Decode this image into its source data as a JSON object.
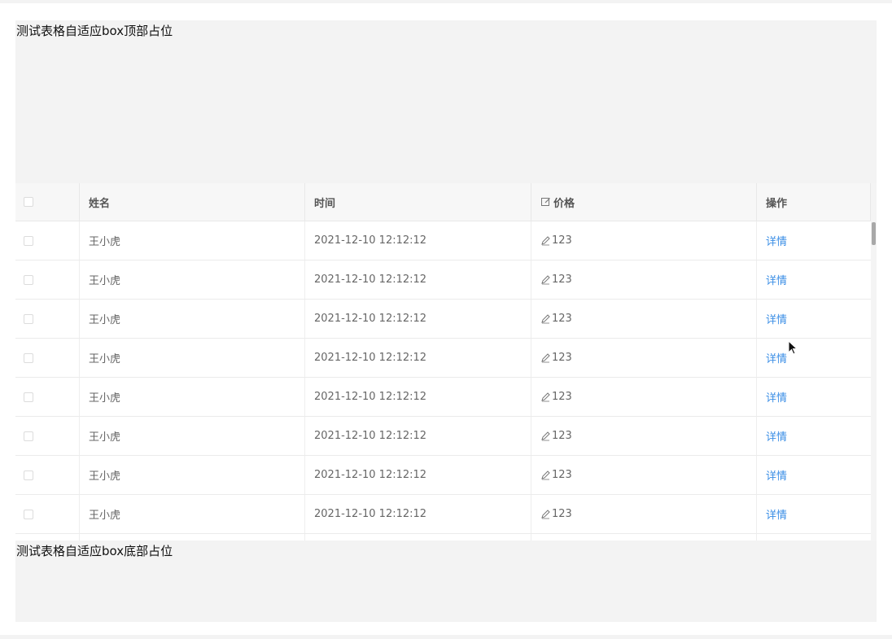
{
  "top_placeholder": {
    "text": "测试表格自适应box顶部占位"
  },
  "bottom_placeholder": {
    "text": "测试表格自适应box底部占位"
  },
  "table": {
    "columns": {
      "name": "姓名",
      "time": "时间",
      "price": "价格",
      "operation": "操作"
    },
    "rows": [
      {
        "name": "王小虎",
        "time": "2021-12-10 12:12:12",
        "price": "123",
        "action": "详情"
      },
      {
        "name": "王小虎",
        "time": "2021-12-10 12:12:12",
        "price": "123",
        "action": "详情"
      },
      {
        "name": "王小虎",
        "time": "2021-12-10 12:12:12",
        "price": "123",
        "action": "详情"
      },
      {
        "name": "王小虎",
        "time": "2021-12-10 12:12:12",
        "price": "123",
        "action": "详情"
      },
      {
        "name": "王小虎",
        "time": "2021-12-10 12:12:12",
        "price": "123",
        "action": "详情"
      },
      {
        "name": "王小虎",
        "time": "2021-12-10 12:12:12",
        "price": "123",
        "action": "详情"
      },
      {
        "name": "王小虎",
        "time": "2021-12-10 12:12:12",
        "price": "123",
        "action": "详情"
      },
      {
        "name": "王小虎",
        "time": "2021-12-10 12:12:12",
        "price": "123",
        "action": "详情"
      }
    ]
  },
  "icons": {
    "price_header": "edit-icon",
    "price_cell": "pen-icon",
    "pointer": "cursor-icon"
  },
  "colors": {
    "link": "#3a8ee6",
    "placeholder_bg": "#f3f3f3",
    "header_bg": "#f7f7f7"
  }
}
